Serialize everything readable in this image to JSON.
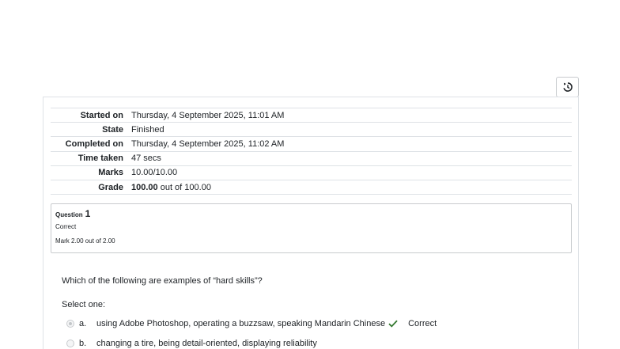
{
  "summary": {
    "rows": [
      {
        "label": "Started on",
        "value": "Thursday, 4 September 2025, 11:01 AM"
      },
      {
        "label": "State",
        "value": "Finished"
      },
      {
        "label": "Completed on",
        "value": "Thursday, 4 September 2025, 11:02 AM"
      },
      {
        "label": "Time taken",
        "value": "47 secs"
      },
      {
        "label": "Marks",
        "value": "10.00/10.00"
      }
    ],
    "grade": {
      "label": "Grade",
      "bold": "100.00",
      "rest": " out of 100.00"
    }
  },
  "question": {
    "title": "Question",
    "number": "1",
    "state": "Correct",
    "mark": "Mark 2.00 out of 2.00",
    "text": "Which of the following are examples of “hard skills”?",
    "prompt": "Select one:",
    "answers": [
      {
        "letter": "a.",
        "text": "using Adobe Photoshop, operating a buzzsaw, speaking Mandarin Chinese",
        "selected": true,
        "feedback": "Correct"
      },
      {
        "letter": "b.",
        "text": "changing a tire, being detail-oriented, displaying reliability",
        "selected": false,
        "feedback": ""
      }
    ]
  },
  "icons": {
    "history": "history-icon",
    "correct": "check-icon"
  },
  "colors": {
    "correct": "#357a32",
    "border": "#dee2e6"
  }
}
